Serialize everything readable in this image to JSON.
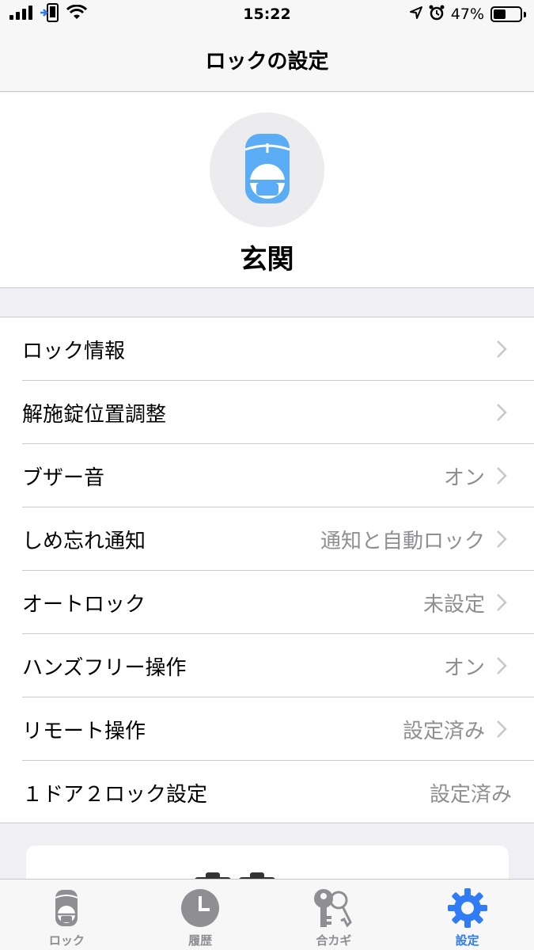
{
  "status_bar": {
    "time": "15:22",
    "battery_percent": "47%",
    "battery_level": 0.47
  },
  "nav": {
    "title": "ロックの設定"
  },
  "device": {
    "name": "玄関",
    "icon": "smart-lock-icon",
    "accent_color": "#5aacf5"
  },
  "settings": [
    {
      "label": "ロック情報",
      "value": "",
      "chevron": true
    },
    {
      "label": "解施錠位置調整",
      "value": "",
      "chevron": true
    },
    {
      "label": "ブザー音",
      "value": "オン",
      "chevron": true
    },
    {
      "label": "しめ忘れ通知",
      "value": "通知と自動ロック",
      "chevron": true
    },
    {
      "label": "オートロック",
      "value": "未設定",
      "chevron": true
    },
    {
      "label": "ハンズフリー操作",
      "value": "オン",
      "chevron": true
    },
    {
      "label": "リモート操作",
      "value": "設定済み",
      "chevron": true
    },
    {
      "label": "１ドア２ロック設定",
      "value": "設定済み",
      "chevron": false
    }
  ],
  "tabs": [
    {
      "label": "ロック",
      "icon": "lock-device-icon",
      "active": false
    },
    {
      "label": "履歴",
      "icon": "clock-icon",
      "active": false
    },
    {
      "label": "合カギ",
      "icon": "keys-icon",
      "active": false
    },
    {
      "label": "設定",
      "icon": "gear-icon",
      "active": true
    }
  ],
  "colors": {
    "active_tab": "#2f7cf6",
    "inactive_tab": "#8e8e93",
    "secondary_text": "#8e8e93"
  }
}
